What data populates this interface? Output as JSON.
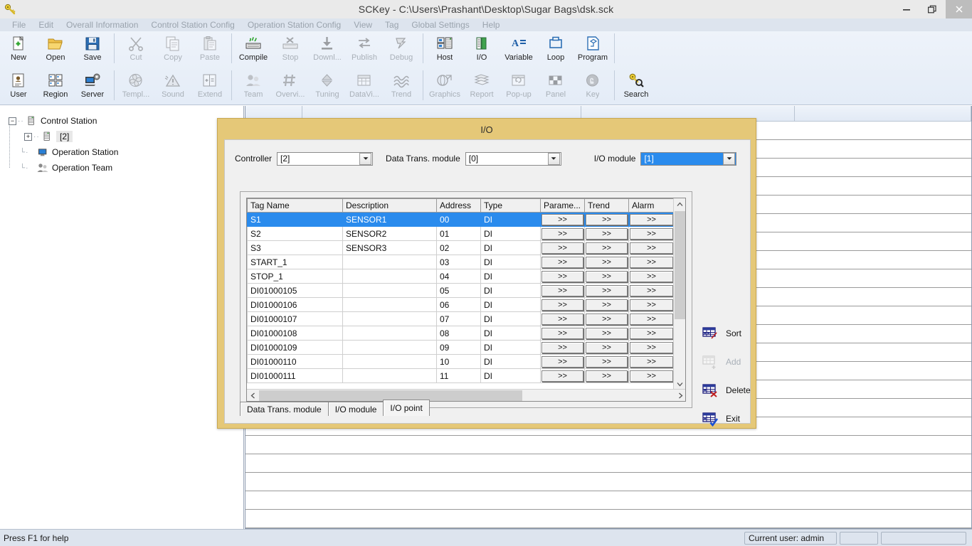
{
  "window": {
    "title": "SCKey - C:\\Users\\Prashant\\Desktop\\Sugar Bags\\dsk.sck",
    "app_icon": "key-icon",
    "minimize_label": "–",
    "maximize_label": "❐",
    "close_label": "✕"
  },
  "menubar": {
    "items": [
      {
        "label": "File"
      },
      {
        "label": "Edit"
      },
      {
        "label": "Overall Information"
      },
      {
        "label": "Control Station Config"
      },
      {
        "label": "Operation Station Config"
      },
      {
        "label": "View"
      },
      {
        "label": "Tag"
      },
      {
        "label": "Global Settings"
      },
      {
        "label": "Help"
      }
    ]
  },
  "toolbar": {
    "row1": [
      {
        "label": "New",
        "icon": "new-document-icon",
        "enabled": true
      },
      {
        "label": "Open",
        "icon": "open-folder-icon",
        "enabled": true
      },
      {
        "label": "Save",
        "icon": "save-disk-icon",
        "enabled": true
      },
      {
        "sep": true
      },
      {
        "label": "Cut",
        "icon": "scissors-icon",
        "enabled": false
      },
      {
        "label": "Copy",
        "icon": "copy-pages-icon",
        "enabled": false
      },
      {
        "label": "Paste",
        "icon": "clipboard-icon",
        "enabled": false
      },
      {
        "sep": true
      },
      {
        "label": "Compile",
        "icon": "compile-icon",
        "enabled": true
      },
      {
        "label": "Stop",
        "icon": "stop-icon",
        "enabled": false
      },
      {
        "label": "Downl...",
        "icon": "download-icon",
        "enabled": false
      },
      {
        "label": "Publish",
        "icon": "publish-arrows-icon",
        "enabled": false
      },
      {
        "label": "Debug",
        "icon": "debug-layers-icon",
        "enabled": false
      },
      {
        "sep": true
      },
      {
        "label": "Host",
        "icon": "host-server-icon",
        "enabled": true
      },
      {
        "label": "I/O",
        "icon": "io-module-icon",
        "enabled": true
      },
      {
        "label": "Variable",
        "icon": "variable-icon",
        "enabled": true
      },
      {
        "label": "Loop",
        "icon": "loop-icon",
        "enabled": true
      },
      {
        "label": "Program",
        "icon": "program-icon",
        "enabled": true
      },
      {
        "sep": true
      }
    ],
    "row2": [
      {
        "label": "User",
        "icon": "user-card-icon",
        "enabled": true
      },
      {
        "label": "Region",
        "icon": "region-grid-icon",
        "enabled": true
      },
      {
        "label": "Server",
        "icon": "server-gear-icon",
        "enabled": true
      },
      {
        "sep": true
      },
      {
        "label": "Templ...",
        "icon": "template-fan-icon",
        "enabled": false
      },
      {
        "label": "Sound",
        "icon": "sound-alarm-icon",
        "enabled": false
      },
      {
        "label": "Extend",
        "icon": "extend-icon",
        "enabled": false
      },
      {
        "sep": true
      },
      {
        "label": "Team",
        "icon": "team-people-icon",
        "enabled": false
      },
      {
        "label": "Overvi...",
        "icon": "overview-hash-icon",
        "enabled": false
      },
      {
        "label": "Tuning",
        "icon": "tuning-diamond-icon",
        "enabled": false
      },
      {
        "label": "DataVi...",
        "icon": "datatable-icon",
        "enabled": false
      },
      {
        "label": "Trend",
        "icon": "trend-wave-icon",
        "enabled": false
      },
      {
        "sep": true
      },
      {
        "label": "Graphics",
        "icon": "graphics-icon",
        "enabled": false
      },
      {
        "label": "Report",
        "icon": "report-stack-icon",
        "enabled": false
      },
      {
        "label": "Pop-up",
        "icon": "popup-window-icon",
        "enabled": false
      },
      {
        "label": "Panel",
        "icon": "panel-checker-icon",
        "enabled": false
      },
      {
        "label": "Key",
        "icon": "key-button-icon",
        "enabled": false
      },
      {
        "sep": true
      },
      {
        "label": "Search",
        "icon": "search-key-icon",
        "enabled": true
      }
    ]
  },
  "tree": {
    "nodes": [
      {
        "label": "Control Station",
        "level": 0,
        "expander": "−",
        "icon": "station-rack-icon",
        "selected": false
      },
      {
        "label": "[2]",
        "level": 1,
        "expander": "+",
        "icon": "station-rack-icon",
        "selected": true
      },
      {
        "label": "Operation Station",
        "level": 0,
        "expander": "",
        "icon": "monitor-icon",
        "selected": false
      },
      {
        "label": "Operation Team",
        "level": 0,
        "expander": "",
        "icon": "team-people-icon",
        "selected": false
      }
    ]
  },
  "dialog": {
    "title": "I/O",
    "controls": [
      {
        "label": "Controller",
        "value": "[2]",
        "name": "controller-select",
        "selected": false
      },
      {
        "label": "Data Trans. module",
        "value": "[0]",
        "name": "data-trans-select",
        "selected": false
      },
      {
        "label": "I/O module",
        "value": "[1]",
        "name": "io-module-select",
        "selected": true
      }
    ],
    "table": {
      "columns": [
        "Tag Name",
        "Description",
        "Address",
        "Type",
        "Parame...",
        "Trend",
        "Alarm"
      ],
      "button_label": ">>",
      "rows": [
        {
          "tag": "S1",
          "desc": "SENSOR1",
          "addr": "00",
          "type": "DI",
          "selected": true
        },
        {
          "tag": "S2",
          "desc": "SENSOR2",
          "addr": "01",
          "type": "DI",
          "selected": false
        },
        {
          "tag": "S3",
          "desc": "SENSOR3",
          "addr": "02",
          "type": "DI",
          "selected": false
        },
        {
          "tag": "START_1",
          "desc": "",
          "addr": "03",
          "type": "DI",
          "selected": false
        },
        {
          "tag": "STOP_1",
          "desc": "",
          "addr": "04",
          "type": "DI",
          "selected": false
        },
        {
          "tag": "DI01000105",
          "desc": "",
          "addr": "05",
          "type": "DI",
          "selected": false
        },
        {
          "tag": "DI01000106",
          "desc": "",
          "addr": "06",
          "type": "DI",
          "selected": false
        },
        {
          "tag": "DI01000107",
          "desc": "",
          "addr": "07",
          "type": "DI",
          "selected": false
        },
        {
          "tag": "DI01000108",
          "desc": "",
          "addr": "08",
          "type": "DI",
          "selected": false
        },
        {
          "tag": "DI01000109",
          "desc": "",
          "addr": "09",
          "type": "DI",
          "selected": false
        },
        {
          "tag": "DI01000110",
          "desc": "",
          "addr": "10",
          "type": "DI",
          "selected": false
        },
        {
          "tag": "DI01000111",
          "desc": "",
          "addr": "11",
          "type": "DI",
          "selected": false
        }
      ]
    },
    "side_buttons": [
      {
        "label": "Sort",
        "icon": "sort-table-icon",
        "enabled": true
      },
      {
        "label": "Add",
        "icon": "add-row-icon",
        "enabled": false
      },
      {
        "label": "Delete",
        "icon": "delete-row-icon",
        "enabled": true
      },
      {
        "label": "Exit",
        "icon": "exit-confirm-icon",
        "enabled": true
      }
    ],
    "tabs": [
      {
        "label": "Data Trans. module",
        "active": false
      },
      {
        "label": "I/O module",
        "active": false
      },
      {
        "label": "I/O point",
        "active": true
      }
    ]
  },
  "statusbar": {
    "help_text": "Press F1 for help",
    "current_user": "Current user: admin",
    "pane_b": "",
    "pane_c": ""
  },
  "colors": {
    "dialog_border": "#e5c878",
    "selection_blue": "#2a8bed",
    "toolbar_bg": "#eaf1fa",
    "menubar_bg": "#dde4ee",
    "statusbar_bg": "#dde4ee"
  }
}
